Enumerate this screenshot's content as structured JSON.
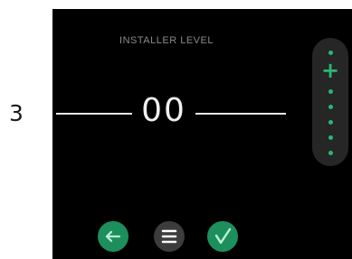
{
  "step": {
    "number": "3"
  },
  "screen": {
    "title": "INSTALLER LEVEL",
    "value": "00"
  },
  "slider": {
    "plus_symbol": "+",
    "icons": [
      "plus-icon",
      "dot-icon"
    ]
  },
  "nav": {
    "back_icon": "arrow-left-icon",
    "menu_icon": "menu-icon",
    "confirm_icon": "checkmark-icon"
  },
  "colors": {
    "accent": "#2bb673",
    "button_green": "#1d8f5c",
    "button_gray": "#3c3c3c",
    "screen_background": "#000000",
    "slider_background": "#262626",
    "text_primary": "#f0f0f0",
    "text_secondary": "#8a8a8a"
  }
}
